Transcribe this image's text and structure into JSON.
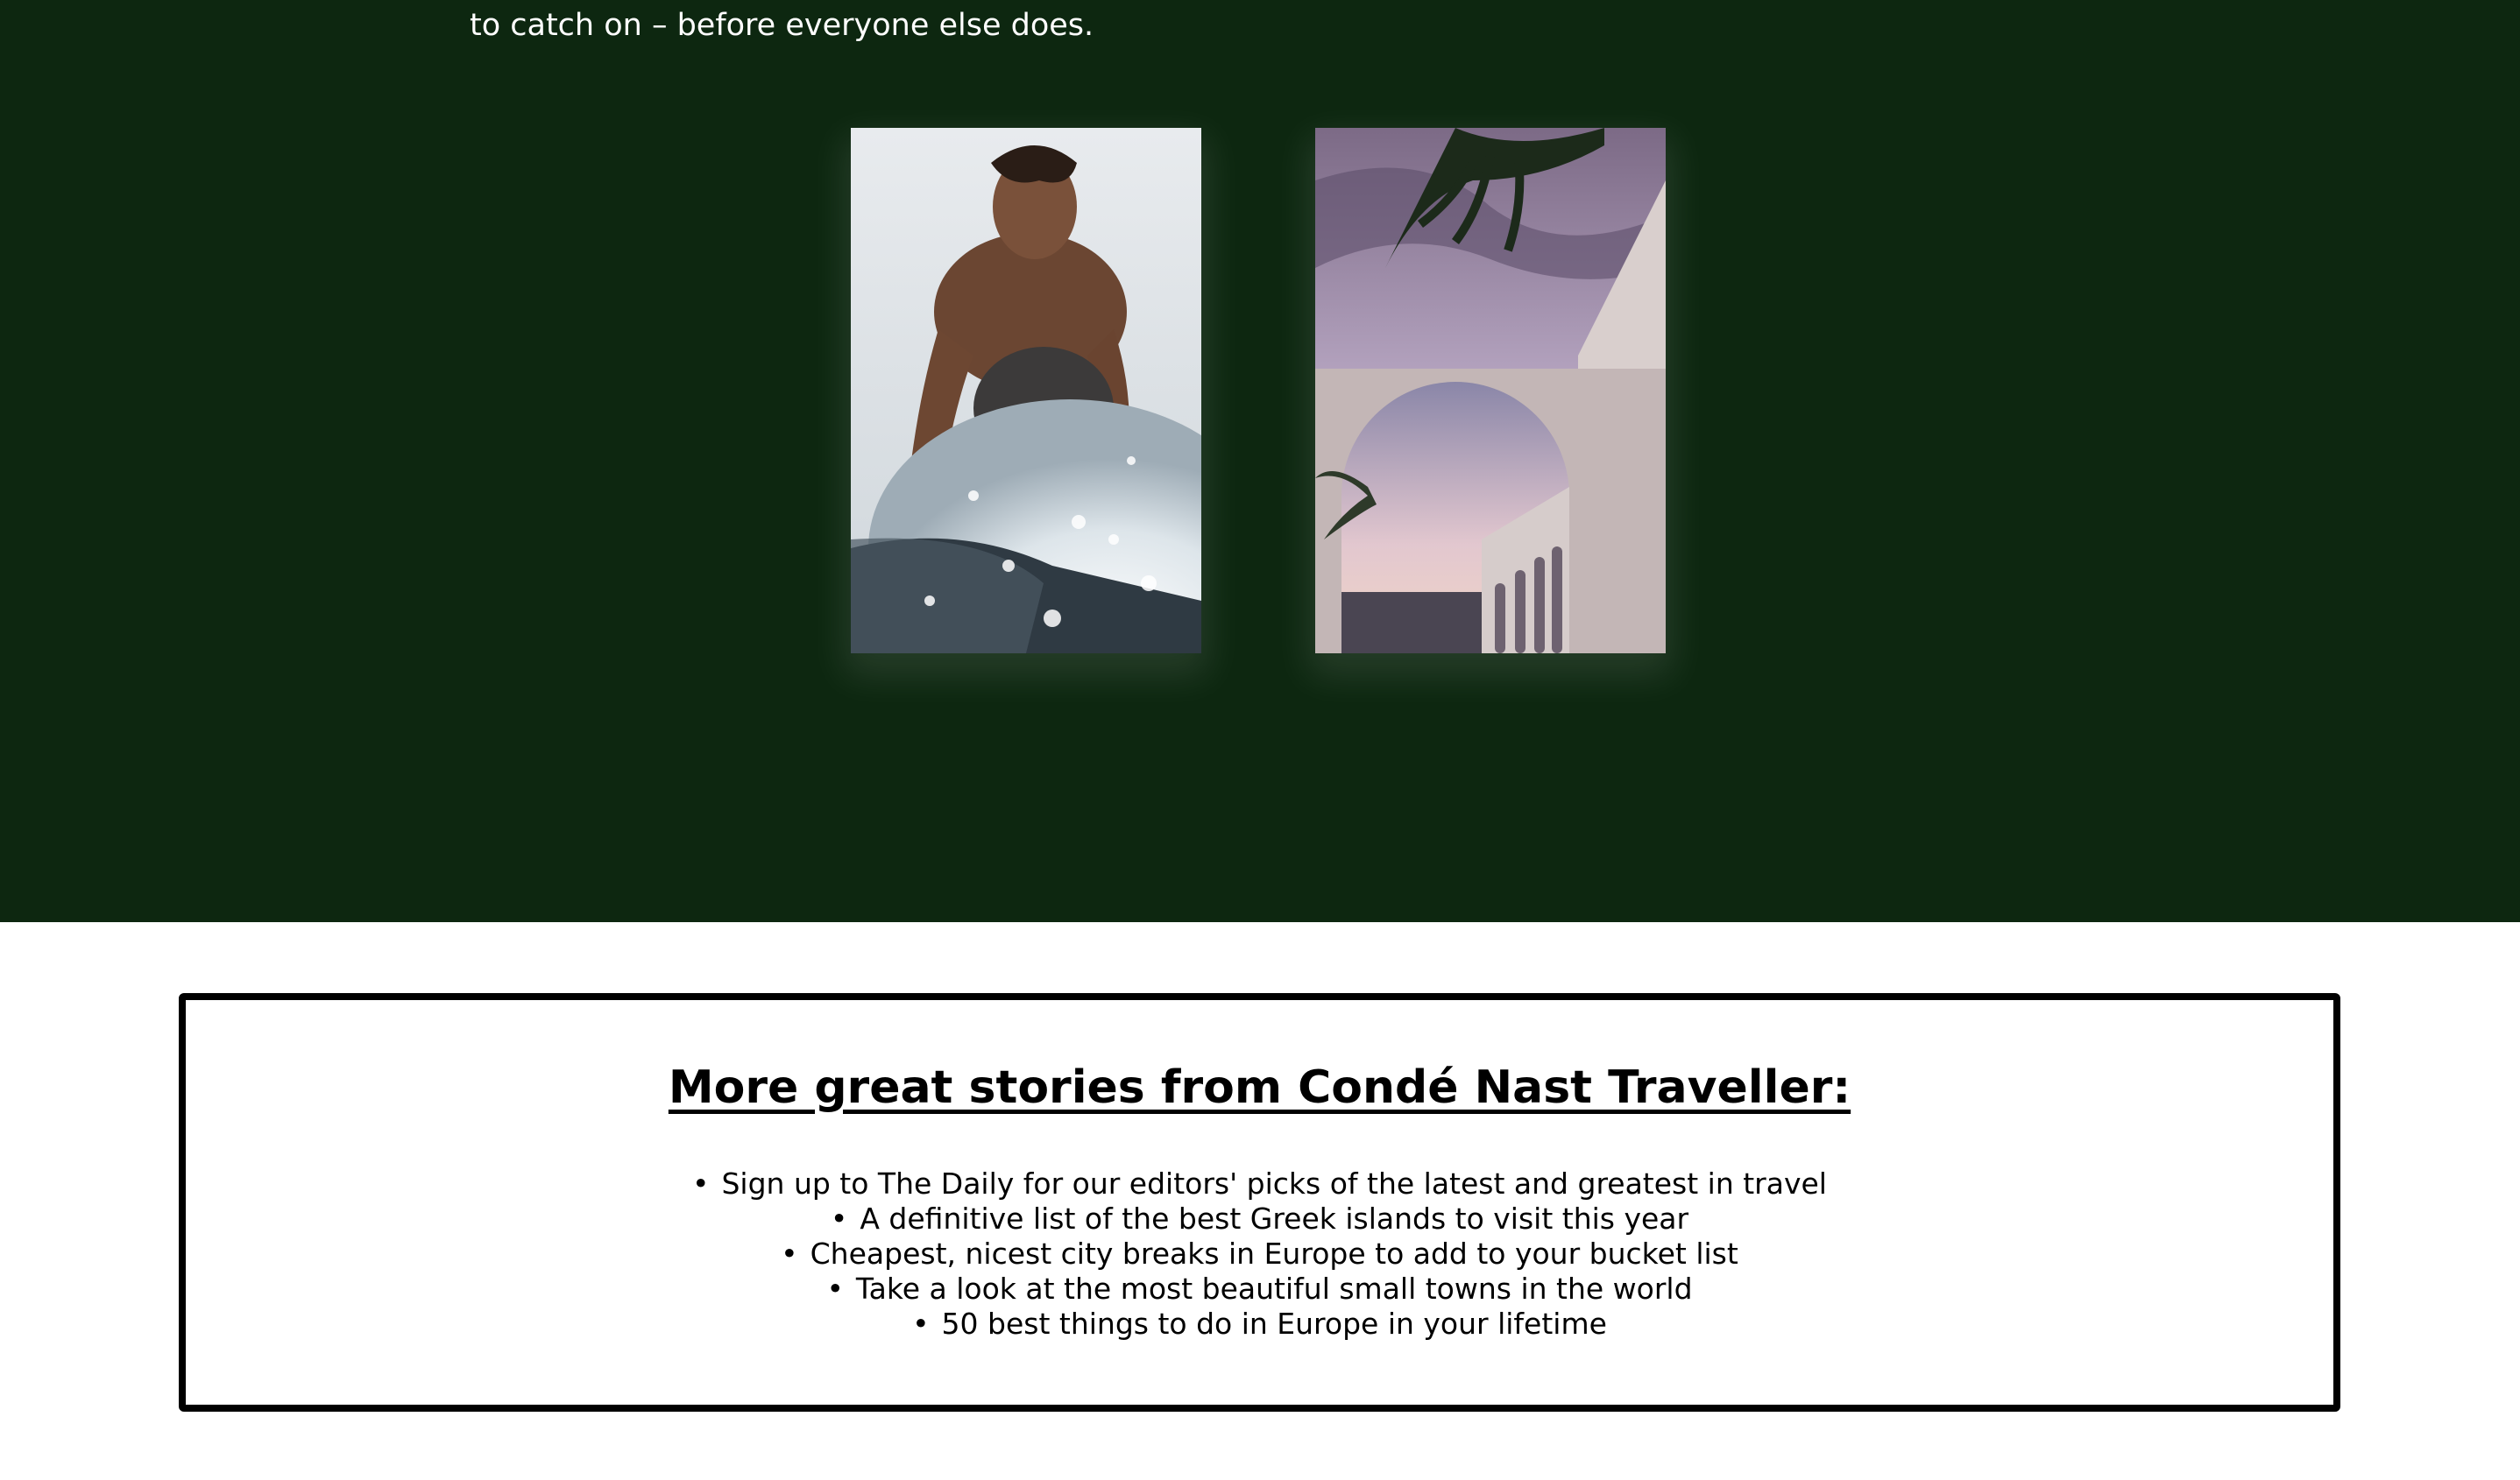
{
  "hero": {
    "background_color": "#0d2710",
    "intro_text_line2": "to catch on – before everyone else does.",
    "images": [
      {
        "name": "surfer-photo",
        "description_icon": "surfer-photo"
      },
      {
        "name": "arch-photo",
        "description_icon": "arch-photo"
      }
    ]
  },
  "stories": {
    "title": "More great stories from Condé Nast Traveller:",
    "items": [
      {
        "label": "Sign up to The Daily for our editors' picks of the latest and greatest in travel"
      },
      {
        "label": "A definitive list of the best Greek islands to visit this year"
      },
      {
        "label": "Cheapest, nicest city breaks in Europe to add to your bucket list"
      },
      {
        "label": "Take a look at the most beautiful small towns in the world"
      },
      {
        "label": "50 best things to do in Europe in your lifetime"
      }
    ]
  }
}
